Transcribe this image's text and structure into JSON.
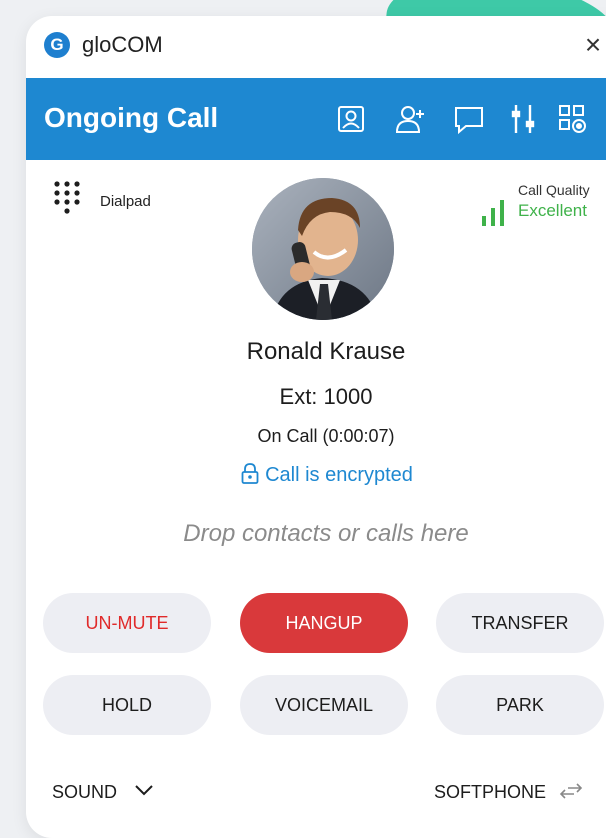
{
  "window": {
    "app_name": "gloCOM",
    "close_label": "×"
  },
  "header": {
    "title": "Ongoing Call",
    "icons": [
      "contact-card-icon",
      "add-user-icon",
      "chat-icon",
      "equalizer-icon",
      "network-icon"
    ]
  },
  "dialpad": {
    "label": "Dialpad"
  },
  "quality": {
    "label": "Call Quality",
    "value": "Excellent",
    "color": "#3fb24a"
  },
  "contact": {
    "name": "Ronald Krause",
    "ext": "Ext: 1000",
    "status": "On Call (0:00:07)",
    "encryption": "Call is encrypted"
  },
  "drop_zone": {
    "text": "Drop contacts or calls here"
  },
  "actions": {
    "mute": "UN-MUTE",
    "hangup": "HANGUP",
    "transfer": "TRANSFER",
    "hold": "HOLD",
    "voicemail": "VOICEMAIL",
    "park": "PARK"
  },
  "footer": {
    "sound": "SOUND",
    "softphone": "SOFTPHONE"
  },
  "colors": {
    "header_bg": "#1e88d1",
    "hangup_bg": "#d9393b",
    "mute_text": "#e02a2a",
    "encrypted_text": "#1e88d1"
  }
}
